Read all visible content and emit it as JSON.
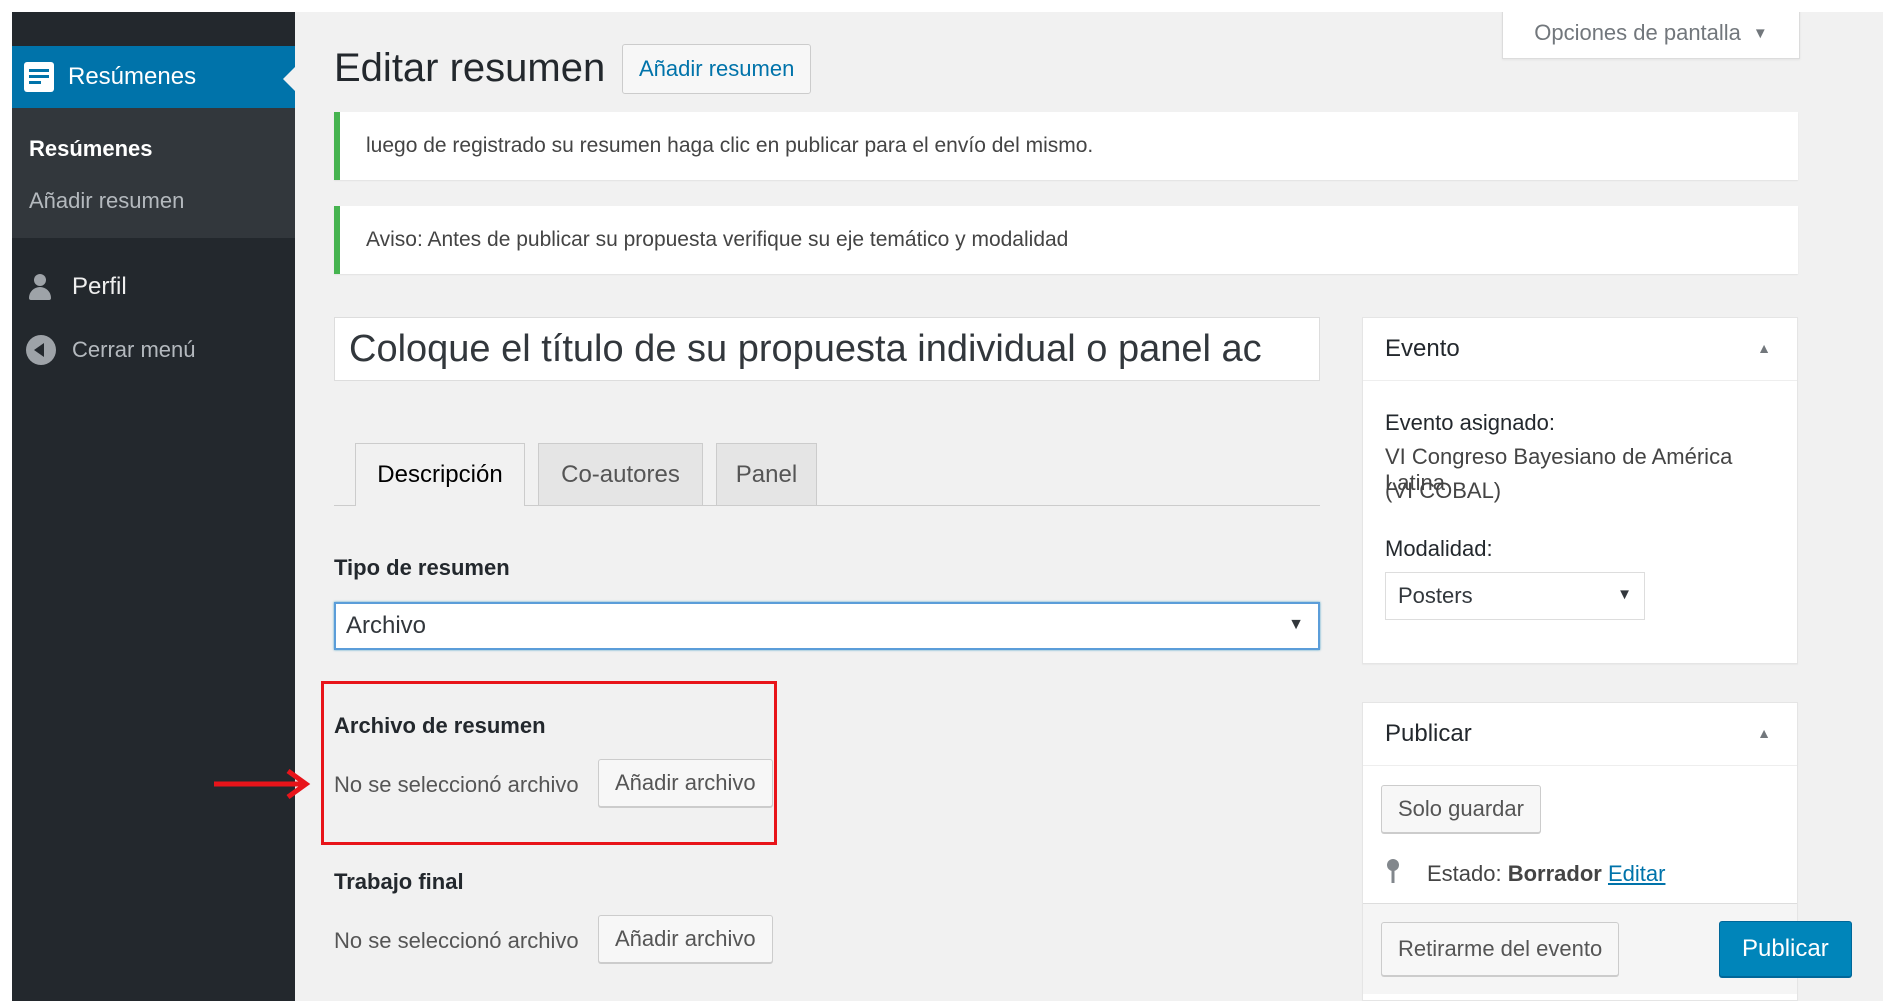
{
  "sidebar": {
    "menu_title": "Resúmenes",
    "submenu": [
      {
        "label": "Resúmenes",
        "current": true
      },
      {
        "label": "Añadir resumen",
        "current": false
      }
    ],
    "profile_label": "Perfil",
    "collapse_label": "Cerrar menú"
  },
  "screen_options": {
    "label": "Opciones de pantalla",
    "caret": "▼"
  },
  "header": {
    "title": "Editar resumen",
    "add_new_label": "Añadir resumen"
  },
  "notices": [
    "luego de registrado su resumen haga clic en publicar para el envío del mismo.",
    "Aviso: Antes de publicar su propuesta verifique su eje temático y modalidad"
  ],
  "title_field": {
    "value": "Coloque el título de su propuesta individual o panel ac"
  },
  "tabs": [
    {
      "label": "Descripción",
      "active": true
    },
    {
      "label": "Co-autores",
      "active": false
    },
    {
      "label": "Panel",
      "active": false
    }
  ],
  "tipo_resumen": {
    "label": "Tipo de resumen",
    "value": "Archivo"
  },
  "archivo_resumen": {
    "label": "Archivo de resumen",
    "status": "No se seleccionó archivo",
    "button": "Añadir archivo"
  },
  "trabajo_final": {
    "label": "Trabajo final",
    "status": "No se seleccionó archivo",
    "button": "Añadir archivo"
  },
  "evento_box": {
    "title": "Evento",
    "assigned_label": "Evento asignado:",
    "event_line1": "VI Congreso Bayesiano de América Latina",
    "event_line2": "(VI COBAL)",
    "modalidad_label": "Modalidad:",
    "modalidad_value": "Posters"
  },
  "publicar_box": {
    "title": "Publicar",
    "save_draft": "Solo guardar",
    "status_label": "Estado:",
    "status_value": "Borrador",
    "edit_link": "Editar",
    "withdraw": "Retirarme del evento",
    "publish": "Publicar"
  },
  "colors": {
    "sidebar_bg": "#23282d",
    "accent": "#0073aa",
    "publish_button": "#0085ba",
    "notice_border": "#46b450",
    "highlight": "#e8141a"
  },
  "icons": [
    "resumenes-icon",
    "user-icon",
    "collapse-icon",
    "pin-icon",
    "arrow-icon"
  ]
}
